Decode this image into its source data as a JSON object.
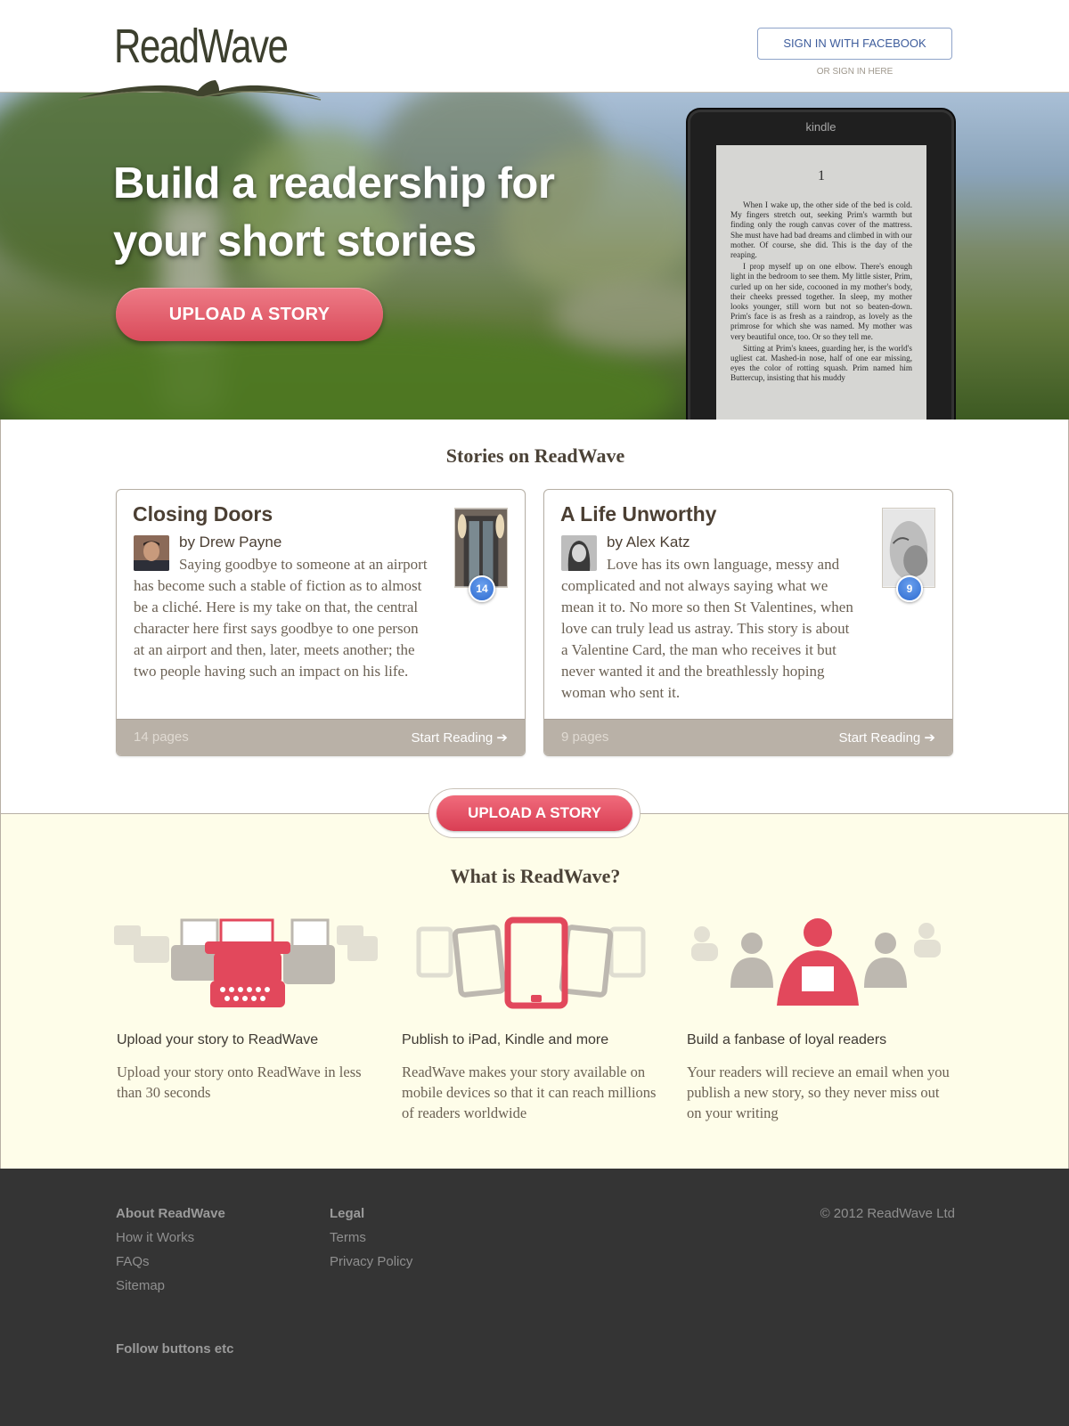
{
  "header": {
    "logo_text": "ReadWave",
    "facebook_button": "SIGN IN WITH FACEBOOK",
    "signin_here": "OR SIGN IN HERE"
  },
  "hero": {
    "title_line1": "Build a readership for",
    "title_line2": "your short stories",
    "upload_button": "UPLOAD A STORY",
    "kindle_brand": "kindle",
    "kindle_page_number": "1",
    "kindle_paragraphs": [
      "When I wake up, the other side of the bed is cold. My fingers stretch out, seeking Prim's warmth but finding only the rough canvas cover of the mattress. She must have had bad dreams and climbed in with our mother. Of course, she did. This is the day of the reaping.",
      "I prop myself up on one elbow. There's enough light in the bedroom to see them. My little sister, Prim, curled up on her side, cocooned in my mother's body, their cheeks pressed together. In sleep, my mother looks younger, still worn but not so beaten-down. Prim's face is as fresh as a raindrop, as lovely as the primrose for which she was named. My mother was very beautiful once, too. Or so they tell me.",
      "Sitting at Prim's knees, guarding her, is the world's ugliest cat. Mashed-in nose, half of one ear missing, eyes the color of rotting squash. Prim named him Buttercup, insisting that his muddy"
    ]
  },
  "stories": {
    "title": "Stories on ReadWave",
    "items": [
      {
        "title": "Closing Doors",
        "author": "by Drew Payne",
        "description": "Saying goodbye to someone at an airport has become such a stable of fiction as to almost be a cliché. Here is my take on that, the central character here first says goodbye to one person at an airport and then, later, meets another; the two people having such an impact on his life.",
        "badge": "14",
        "pages": "14 pages",
        "read": "Start Reading ➔"
      },
      {
        "title": "A Life Unworthy",
        "author": "by Alex Katz",
        "description": "Love has its own language, messy and complicated and not always saying what we mean it to. No more so then St Valentines, when love can truly lead us astray. This story is about a Valentine Card, the man who receives it but never wanted it and the breathlessly hoping woman who sent it.",
        "badge": "9",
        "pages": "9 pages",
        "read": "Start Reading ➔"
      }
    ],
    "upload_button": "UPLOAD A STORY"
  },
  "what": {
    "title": "What is ReadWave?",
    "features": [
      {
        "icon": "typewriter-icon",
        "title": "Upload your story to ReadWave",
        "description": "Upload your story onto ReadWave in less than 30 seconds"
      },
      {
        "icon": "tablet-icon",
        "title": "Publish to iPad, Kindle and more",
        "description": "ReadWave makes your story available on mobile devices so that it can reach millions of readers worldwide"
      },
      {
        "icon": "readers-icon",
        "title": "Build a fanbase of loyal readers",
        "description": "Your readers will recieve an email when you publish a new story, so they never miss out on your writing"
      }
    ]
  },
  "footer": {
    "col1": {
      "heading": "About ReadWave",
      "links": [
        "How it Works",
        "FAQs",
        "Sitemap"
      ]
    },
    "col2": {
      "heading": "Legal",
      "links": [
        "Terms",
        "Privacy Policy"
      ]
    },
    "copyright": "© 2012 ReadWave Ltd",
    "follow": "Follow buttons etc"
  },
  "colors": {
    "accent_red": "#e2485c",
    "badge_blue": "#2e6bd0",
    "footer_bg": "#343434",
    "cream": "#fefde9"
  }
}
